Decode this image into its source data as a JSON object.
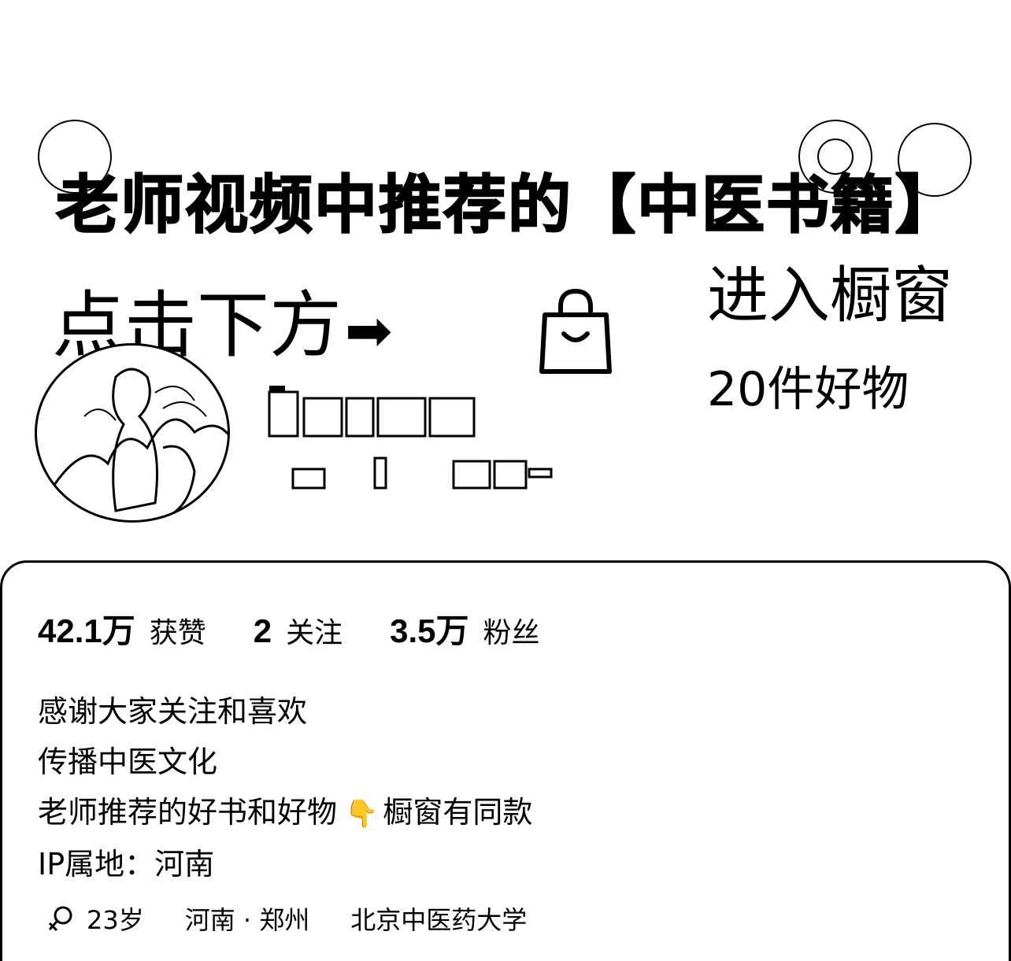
{
  "banner": {
    "headline": "老师视频中推荐的【中医书籍】",
    "click_below": "点击下方",
    "arrow": "➡",
    "enter_window": "进入橱窗",
    "goods_count": "20件好物"
  },
  "profile": {
    "stats": [
      {
        "value": "42.1万",
        "label": "获赞"
      },
      {
        "value": "2",
        "label": "关注"
      },
      {
        "value": "3.5万",
        "label": "粉丝"
      }
    ],
    "bio": {
      "line1": "感谢大家关注和喜欢",
      "line2": "传播中医文化",
      "line3_prefix": "老师推荐的好书和好物",
      "line3_icon": "👇",
      "line3_suffix": "橱窗有同款",
      "line4": "IP属地：河南"
    },
    "meta": {
      "age": "23岁",
      "location": "河南 · 郑州",
      "school": "北京中医药大学"
    }
  },
  "icons": {
    "bag": "shopping-bag-icon",
    "gender": "female-icon",
    "pointing": "pointing-down-icon"
  }
}
